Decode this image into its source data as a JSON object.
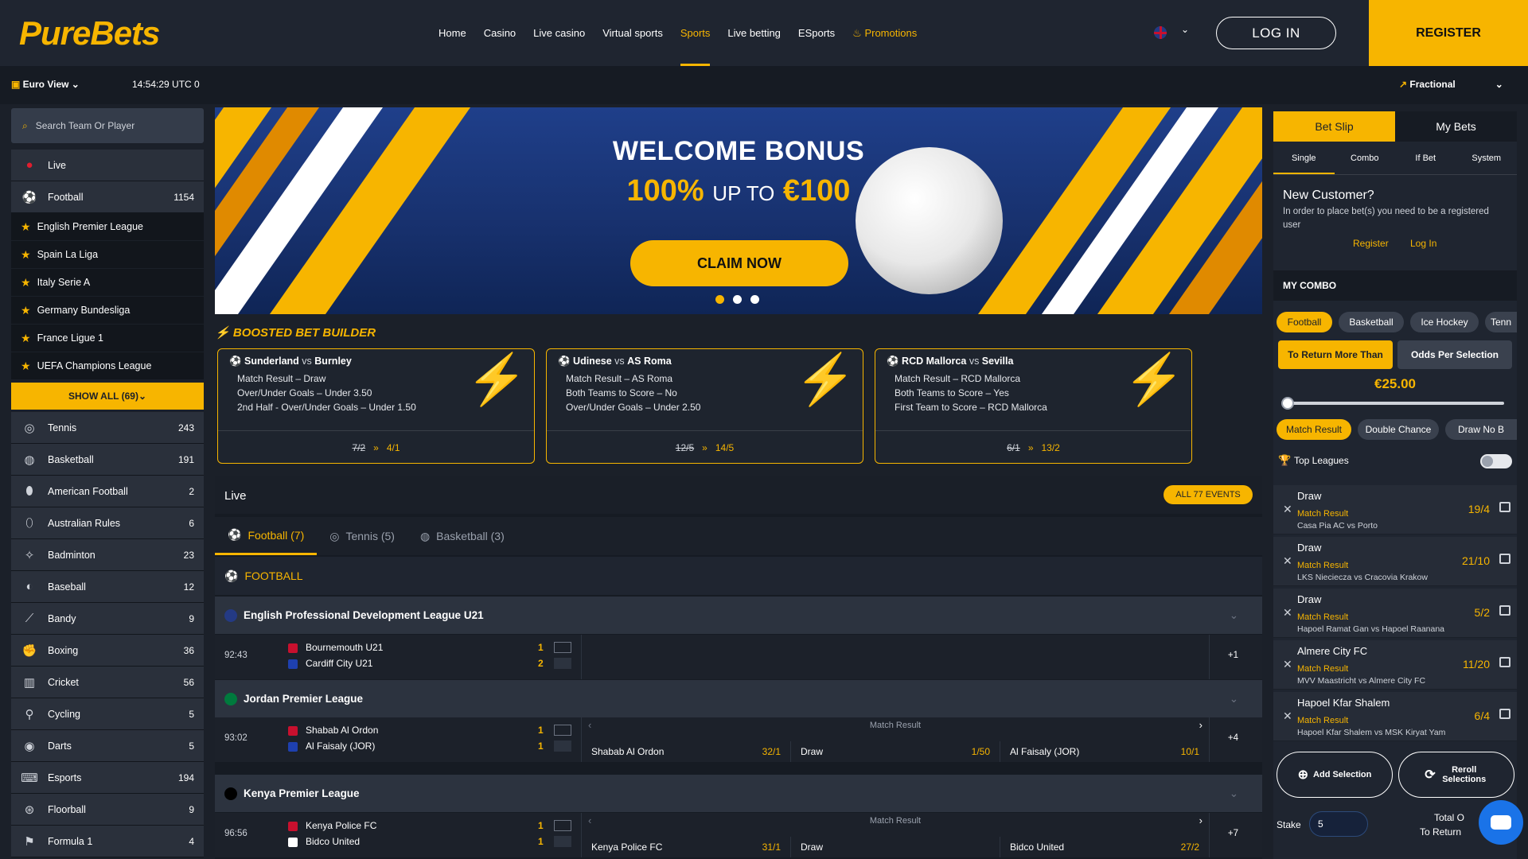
{
  "header": {
    "logo": "PureBets",
    "nav": [
      "Home",
      "Casino",
      "Live casino",
      "Virtual sports",
      "Sports",
      "Live betting",
      "ESports",
      "Promotions"
    ],
    "active_nav": "Sports",
    "login": "LOG IN",
    "register": "REGISTER"
  },
  "subbar": {
    "view": "Euro View",
    "time": "14:54:29 UTC 0",
    "odds_format": "Fractional"
  },
  "sidebar": {
    "search_placeholder": "Search Team Or Player",
    "live": "Live",
    "football": {
      "label": "Football",
      "count": "1154"
    },
    "leagues": [
      "English Premier League",
      "Spain La Liga",
      "Italy Serie A",
      "Germany Bundesliga",
      "France Ligue 1",
      "UEFA Champions League"
    ],
    "show_all": "SHOW ALL (69)",
    "sports": [
      {
        "label": "Tennis",
        "count": "243",
        "icon": "tennis-icon"
      },
      {
        "label": "Basketball",
        "count": "191",
        "icon": "basketball-icon"
      },
      {
        "label": "American Football",
        "count": "2",
        "icon": "american-football-icon"
      },
      {
        "label": "Australian Rules",
        "count": "6",
        "icon": "australian-rules-icon"
      },
      {
        "label": "Badminton",
        "count": "23",
        "icon": "badminton-icon"
      },
      {
        "label": "Baseball",
        "count": "12",
        "icon": "baseball-icon"
      },
      {
        "label": "Bandy",
        "count": "9",
        "icon": "bandy-icon"
      },
      {
        "label": "Boxing",
        "count": "36",
        "icon": "boxing-icon"
      },
      {
        "label": "Cricket",
        "count": "56",
        "icon": "cricket-icon"
      },
      {
        "label": "Cycling",
        "count": "5",
        "icon": "cycling-icon"
      },
      {
        "label": "Darts",
        "count": "5",
        "icon": "darts-icon"
      },
      {
        "label": "Esports",
        "count": "194",
        "icon": "esports-icon"
      },
      {
        "label": "Floorball",
        "count": "9",
        "icon": "floorball-icon"
      },
      {
        "label": "Formula 1",
        "count": "4",
        "icon": "formula1-icon"
      }
    ]
  },
  "banner": {
    "title": "WELCOME BONUS",
    "pct": "100%",
    "up_to": "UP TO",
    "amount": "€100",
    "cta": "CLAIM NOW"
  },
  "boosted": {
    "title": "BOOSTED BET BUILDER",
    "cards": [
      {
        "home": "Sunderland",
        "vs": "vs",
        "away": "Burnley",
        "lines": [
          "Match Result – Draw",
          "Over/Under Goals – Under 3.50",
          "2nd Half - Over/Under Goals – Under 1.50"
        ],
        "old": "7/2",
        "new": "4/1"
      },
      {
        "home": "Udinese",
        "vs": "vs",
        "away": "AS Roma",
        "lines": [
          "Match Result – AS Roma",
          "Both Teams to Score – No",
          "Over/Under Goals – Under 2.50"
        ],
        "old": "12/5",
        "new": "14/5"
      },
      {
        "home": "RCD Mallorca",
        "vs": "vs",
        "away": "Sevilla",
        "lines": [
          "Match Result – RCD Mallorca",
          "Both Teams to Score – Yes",
          "First Team to Score – RCD Mallorca"
        ],
        "old": "6/1",
        "new": "13/2"
      }
    ]
  },
  "live": {
    "title": "Live",
    "all_events": "ALL 77 EVENTS",
    "tabs": [
      "Football (7)",
      "Tennis (5)",
      "Basketball (3)"
    ],
    "section": "FOOTBALL",
    "leagues": [
      {
        "name": "English Professional Development League U21",
        "match": {
          "time": "92:43",
          "home": "Bournemouth U21",
          "away": "Cardiff City U21",
          "hs": "1",
          "as": "2",
          "more": "+1"
        }
      },
      {
        "name": "Jordan Premier League",
        "match": {
          "time": "93:02",
          "home": "Shabab Al Ordon",
          "away": "Al Faisaly (JOR)",
          "hs": "1",
          "as": "1",
          "more": "+4",
          "market": "Match Result",
          "odds": [
            {
              "label": "Shabab Al Ordon",
              "value": "32/1"
            },
            {
              "label": "Draw",
              "value": "1/50"
            },
            {
              "label": "Al Faisaly (JOR)",
              "value": "10/1"
            }
          ]
        }
      },
      {
        "name": "Kenya Premier League",
        "match": {
          "time": "96:56",
          "home": "Kenya Police FC",
          "away": "Bidco United",
          "hs": "1",
          "as": "1",
          "more": "+7",
          "market": "Match Result",
          "odds": [
            {
              "label": "Kenya Police FC",
              "value": "31/1"
            },
            {
              "label": "Draw",
              "value": ""
            },
            {
              "label": "Bidco United",
              "value": "27/2"
            }
          ]
        }
      }
    ]
  },
  "betslip": {
    "tabs": [
      "Bet Slip",
      "My Bets"
    ],
    "subtabs": [
      "Single",
      "Combo",
      "If Bet",
      "System"
    ],
    "new_customer": "New Customer?",
    "new_customer_desc": "In order to place bet(s) you need to be a registered user",
    "register": "Register",
    "login": "Log In",
    "my_combo": "MY COMBO",
    "sports": [
      "Football",
      "Basketball",
      "Ice Hockey",
      "Tenn"
    ],
    "mode1": "To Return More Than",
    "mode2": "Odds Per Selection",
    "amount": "€25.00",
    "slider_fraction": 0,
    "markets": [
      "Match Result",
      "Double Chance",
      "Draw No B"
    ],
    "top_leagues": "Top Leagues",
    "selections": [
      {
        "name": "Draw",
        "market": "Match Result",
        "event": "Casa Pia AC vs Porto",
        "odds": "19/4"
      },
      {
        "name": "Draw",
        "market": "Match Result",
        "event": "LKS Nieciecza vs Cracovia Krakow",
        "odds": "21/10"
      },
      {
        "name": "Draw",
        "market": "Match Result",
        "event": "Hapoel Ramat Gan vs Hapoel Raanana",
        "odds": "5/2"
      },
      {
        "name": "Almere City FC",
        "market": "Match Result",
        "event": "MVV Maastricht vs Almere City FC",
        "odds": "11/20"
      },
      {
        "name": "Hapoel Kfar Shalem",
        "market": "Match Result",
        "event": "Hapoel Kfar Shalem vs MSK Kiryat Yam",
        "odds": "6/4"
      }
    ],
    "add_selection": "Add Selection",
    "reroll": "Reroll Selections",
    "stake_label": "Stake",
    "stake_value": "5",
    "total_odds": "Total O",
    "to_return": "To Return"
  }
}
